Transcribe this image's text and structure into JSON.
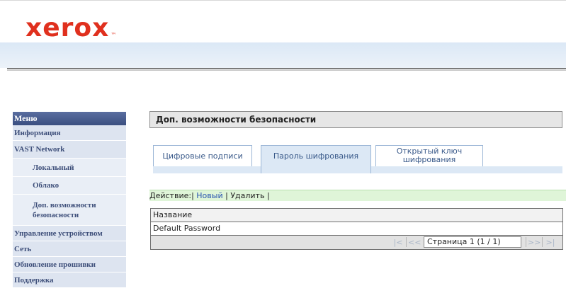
{
  "brand": {
    "logo_text": "xerox",
    "logo_mark": "™",
    "color": "#e0301e"
  },
  "sidebar": {
    "title": "Меню",
    "items": [
      {
        "label": "Информация"
      },
      {
        "label": "VAST Network"
      },
      {
        "label": "Локальный"
      },
      {
        "label": "Облако"
      },
      {
        "label": "Доп. возможности безопасности"
      },
      {
        "label": "Управление устройством"
      },
      {
        "label": "Сеть"
      },
      {
        "label": "Обновление прошивки"
      },
      {
        "label": "Поддержка"
      }
    ]
  },
  "main": {
    "title": "Доп. возможности безопасности",
    "tabs": [
      {
        "label": "Цифровые подписи"
      },
      {
        "label": "Пароль шифрования",
        "active": true
      },
      {
        "label_line1": "Открытый ключ",
        "label_line2": "шифрования"
      }
    ],
    "actions": {
      "prefix": "Действие:|",
      "new_label": "Новый",
      "sep": "|",
      "delete_label": "Удалить |"
    },
    "table": {
      "column": "Название",
      "rows": [
        "Default Password"
      ]
    },
    "pager": {
      "first": "|<",
      "prev": "<<",
      "page_text": "Страница 1 (1 / 1)",
      "next": ">>",
      "last": ">|"
    }
  }
}
